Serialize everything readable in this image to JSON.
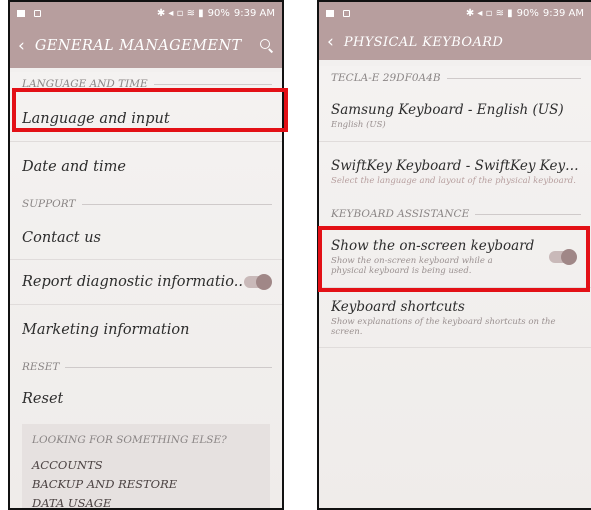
{
  "status_bar": {
    "battery": "90%",
    "time": "9:39 AM"
  },
  "left": {
    "title": "GENERAL MANAGEMENT",
    "sections": {
      "language": "LANGUAGE AND TIME",
      "support": "SUPPORT",
      "reset": "RESET"
    },
    "items": {
      "language_input": "Language and input",
      "date_time": "Date and time",
      "contact": "Contact us",
      "report": "Report diagnostic informatio..",
      "marketing": "Marketing information",
      "reset": "Reset"
    },
    "report_toggle_on": true,
    "suggestions": {
      "title": "LOOKING FOR SOMETHING ELSE?",
      "links": [
        "ACCOUNTS",
        "BACKUP AND RESTORE",
        "DATA USAGE"
      ]
    }
  },
  "right": {
    "title": "PHYSICAL KEYBOARD",
    "device_section": "TECLA-E 29DF0A4B",
    "samsung": {
      "label": "Samsung Keyboard - English (US)",
      "sub": "English (US)"
    },
    "swiftkey": {
      "label": "SwiftKey Keyboard - SwiftKey Keybo..",
      "sub": "Select the language and layout of the physical keyboard."
    },
    "assist_section": "KEYBOARD ASSISTANCE",
    "onscreen": {
      "label": "Show the on-screen keyboard",
      "sub": "Show the on-screen keyboard while a physical keyboard is being used.",
      "toggle_on": true
    },
    "shortcuts": {
      "label": "Keyboard shortcuts",
      "sub": "Show explanations of the keyboard shortcuts on the screen."
    }
  },
  "colors": {
    "header": "#b79e9e",
    "highlight": "#e31016",
    "toggle": "#a08787"
  }
}
